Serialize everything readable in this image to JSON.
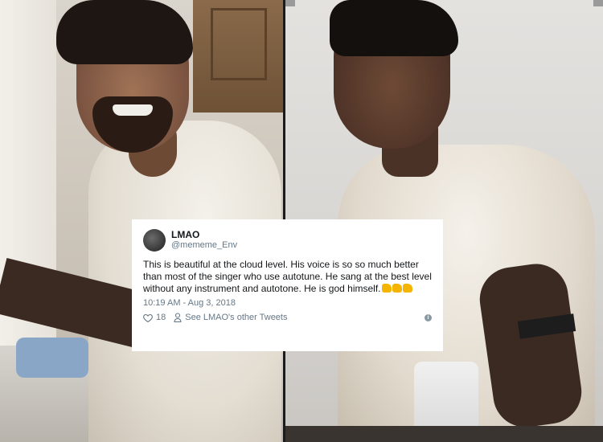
{
  "tweet": {
    "display_name": "LMAO",
    "handle": "@mememe_Env",
    "text": "This is beautiful at the cloud level. His voice is so so much better than most of the singer who use autotune. He sang at the best level without any instrument and autotone. He is god himself.",
    "emoji_count": 3,
    "timestamp": "10:19 AM - Aug 3, 2018",
    "likes": "18",
    "see_others": "See LMAO's other Tweets"
  },
  "icons": {
    "like": "heart-icon",
    "profile": "person-icon",
    "info": "info-icon",
    "emoji": "clapping-hands-emoji"
  },
  "colors": {
    "card_background": "#ffffff",
    "primary_text": "#14171a",
    "secondary_text": "#657786"
  }
}
